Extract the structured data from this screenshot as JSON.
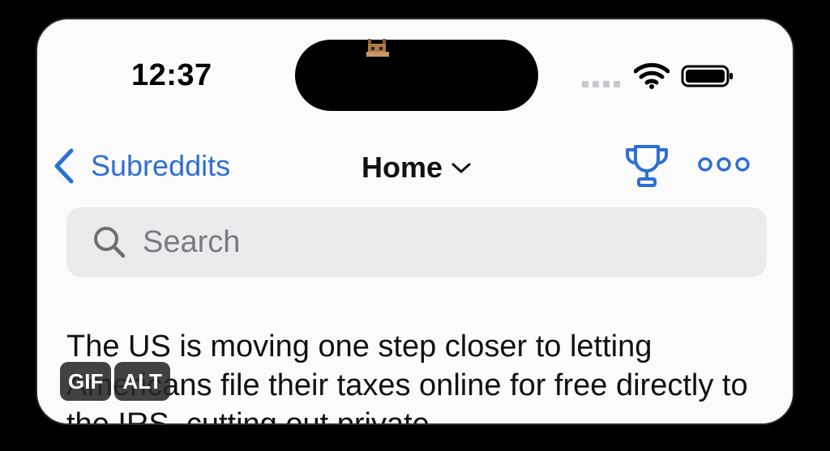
{
  "status_bar": {
    "time": "12:37"
  },
  "nav": {
    "back_label": "Subreddits",
    "title": "Home"
  },
  "search": {
    "placeholder": "Search"
  },
  "post": {
    "text": "The US is moving one step closer to letting Americans file their taxes online for free directly to the IRS, cutting out private"
  },
  "media_badges": {
    "gif": "GIF",
    "alt": "ALT"
  },
  "colors": {
    "accent": "#2d6fd6",
    "background": "#fbfbfc",
    "search_bg": "#ebebed"
  },
  "icons": {
    "back": "chevron-left-icon",
    "dropdown": "chevron-down-icon",
    "trophy": "trophy-icon",
    "more": "ellipsis-icon",
    "search": "search-icon"
  }
}
